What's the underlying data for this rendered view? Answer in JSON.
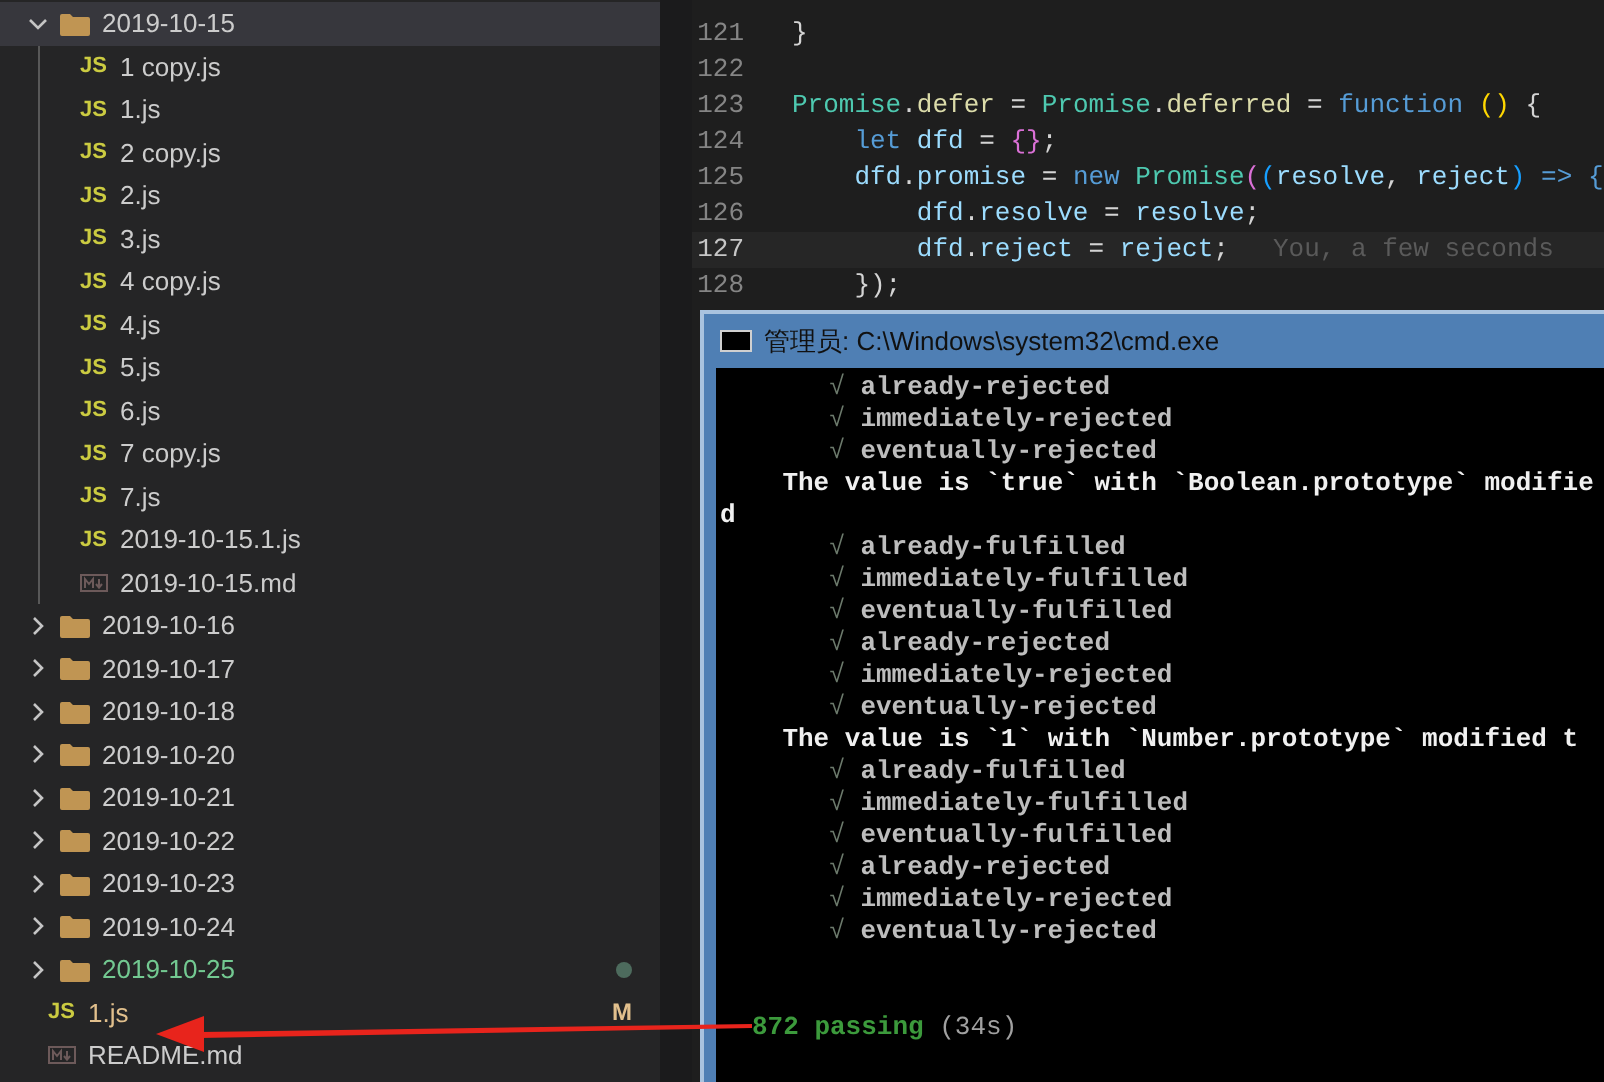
{
  "explorer": {
    "items": [
      {
        "kind": "folder",
        "name": "2019-10-15",
        "expanded": true,
        "selected": true,
        "children": [
          {
            "kind": "js",
            "icon_label": "JS",
            "name": "1 copy.js"
          },
          {
            "kind": "js",
            "icon_label": "JS",
            "name": "1.js"
          },
          {
            "kind": "js",
            "icon_label": "JS",
            "name": "2 copy.js"
          },
          {
            "kind": "js",
            "icon_label": "JS",
            "name": "2.js"
          },
          {
            "kind": "js",
            "icon_label": "JS",
            "name": "3.js"
          },
          {
            "kind": "js",
            "icon_label": "JS",
            "name": "4 copy.js"
          },
          {
            "kind": "js",
            "icon_label": "JS",
            "name": "4.js"
          },
          {
            "kind": "js",
            "icon_label": "JS",
            "name": "5.js"
          },
          {
            "kind": "js",
            "icon_label": "JS",
            "name": "6.js"
          },
          {
            "kind": "js",
            "icon_label": "JS",
            "name": "7 copy.js"
          },
          {
            "kind": "js",
            "icon_label": "JS",
            "name": "7.js"
          },
          {
            "kind": "js",
            "icon_label": "JS",
            "name": "2019-10-15.1.js"
          },
          {
            "kind": "md",
            "name": "2019-10-15.md"
          }
        ]
      },
      {
        "kind": "folder",
        "name": "2019-10-16",
        "expanded": false,
        "selected": false,
        "untracked": false
      },
      {
        "kind": "folder",
        "name": "2019-10-17",
        "expanded": false,
        "selected": false,
        "untracked": false
      },
      {
        "kind": "folder",
        "name": "2019-10-18",
        "expanded": false,
        "selected": false,
        "untracked": false
      },
      {
        "kind": "folder",
        "name": "2019-10-20",
        "expanded": false,
        "selected": false,
        "untracked": false
      },
      {
        "kind": "folder",
        "name": "2019-10-21",
        "expanded": false,
        "selected": false,
        "untracked": false
      },
      {
        "kind": "folder",
        "name": "2019-10-22",
        "expanded": false,
        "selected": false,
        "untracked": false
      },
      {
        "kind": "folder",
        "name": "2019-10-23",
        "expanded": false,
        "selected": false,
        "untracked": false
      },
      {
        "kind": "folder",
        "name": "2019-10-24",
        "expanded": false,
        "selected": false,
        "untracked": false
      },
      {
        "kind": "folder",
        "name": "2019-10-25",
        "expanded": false,
        "selected": false,
        "untracked": true
      },
      {
        "kind": "js",
        "icon_label": "JS",
        "name": "1.js",
        "untracked": false,
        "badge": "M"
      },
      {
        "kind": "md",
        "name": "README.md",
        "untracked": false
      }
    ]
  },
  "editor": {
    "lines": [
      {
        "number": "121",
        "current": false,
        "tokens": [
          {
            "text": "}",
            "kind": "punct"
          }
        ]
      },
      {
        "number": "122",
        "current": false
      },
      {
        "number": "123",
        "current": false,
        "tokens": [
          {
            "text": "Promise",
            "kind": "class"
          },
          {
            "text": ".",
            "kind": "punct"
          },
          {
            "text": "defer",
            "kind": "prop"
          },
          {
            "text": " = ",
            "kind": "punct"
          },
          {
            "text": "Promise",
            "kind": "class"
          },
          {
            "text": ".",
            "kind": "punct"
          },
          {
            "text": "deferred",
            "kind": "func"
          },
          {
            "text": " = ",
            "kind": "punct"
          },
          {
            "text": "function ",
            "kind": "keyword"
          },
          {
            "text": "()",
            "kind": "bracket"
          },
          {
            "text": " {",
            "kind": "punct"
          }
        ]
      },
      {
        "number": "124",
        "current": false,
        "kind": "nested",
        "tokens": [
          {
            "text": "let ",
            "kind": "keyword"
          },
          {
            "text": "dfd",
            "kind": "var"
          },
          {
            "text": " = ",
            "kind": "punct"
          },
          {
            "text": "{}",
            "kind": "bracket2"
          },
          {
            "text": ";",
            "kind": "punct"
          }
        ]
      },
      {
        "number": "125",
        "current": false,
        "kind": "nested",
        "tokens": [
          {
            "text": "dfd",
            "kind": "var"
          },
          {
            "text": ".",
            "kind": "punct"
          },
          {
            "text": "promise",
            "kind": "var"
          },
          {
            "text": " = ",
            "kind": "punct"
          },
          {
            "text": "new ",
            "kind": "keyword"
          },
          {
            "text": "Promise",
            "kind": "class"
          },
          {
            "text": "(",
            "kind": "bracket2"
          },
          {
            "text": "(",
            "kind": "bracket3"
          },
          {
            "text": "resolve",
            "kind": "var"
          },
          {
            "text": ", ",
            "kind": "punct"
          },
          {
            "text": "reject",
            "kind": "var"
          },
          {
            "text": ")",
            "kind": "bracket3"
          },
          {
            "text": " => {",
            "kind": "keyword"
          }
        ]
      },
      {
        "number": "126",
        "current": false,
        "kind": "deep",
        "tokens": [
          {
            "text": "dfd",
            "kind": "var"
          },
          {
            "text": ".",
            "kind": "punct"
          },
          {
            "text": "resolve",
            "kind": "var"
          },
          {
            "text": " = ",
            "kind": "punct"
          },
          {
            "text": "resolve",
            "kind": "var"
          },
          {
            "text": ";",
            "kind": "punct"
          }
        ]
      },
      {
        "number": "127",
        "current": true,
        "kind": "deep",
        "tokens": [
          {
            "text": "dfd",
            "kind": "var"
          },
          {
            "text": ".",
            "kind": "punct"
          },
          {
            "text": "reject",
            "kind": "var"
          },
          {
            "text": " = ",
            "kind": "punct"
          },
          {
            "text": "reject",
            "kind": "var"
          },
          {
            "text": ";",
            "kind": "punct"
          }
        ],
        "blame": "You, a few seconds"
      },
      {
        "number": "128",
        "current": false,
        "kind": "nested",
        "tokens": [
          {
            "text": "});",
            "kind": "punct"
          }
        ]
      }
    ]
  },
  "console": {
    "title": "管理员: C:\\Windows\\system32\\cmd.exe",
    "lines": [
      {
        "kind": "pass",
        "check": "√",
        "text": "already-rejected"
      },
      {
        "kind": "pass",
        "check": "√",
        "text": "immediately-rejected"
      },
      {
        "kind": "pass",
        "check": "√",
        "text": "eventually-rejected"
      },
      {
        "kind": "message",
        "text": "The value is `true` with `Boolean.prototype` modifie"
      },
      {
        "kind": "plain",
        "text": "d"
      },
      {
        "kind": "pass",
        "check": "√",
        "text": "already-fulfilled"
      },
      {
        "kind": "pass",
        "check": "√",
        "text": "immediately-fulfilled"
      },
      {
        "kind": "pass",
        "check": "√",
        "text": "eventually-fulfilled"
      },
      {
        "kind": "pass",
        "check": "√",
        "text": "already-rejected"
      },
      {
        "kind": "pass",
        "check": "√",
        "text": "immediately-rejected"
      },
      {
        "kind": "pass",
        "check": "√",
        "text": "eventually-rejected"
      },
      {
        "kind": "message",
        "text": "The value is `1` with `Number.prototype` modified t"
      },
      {
        "kind": "pass",
        "check": "√",
        "text": "already-fulfilled"
      },
      {
        "kind": "pass",
        "check": "√",
        "text": "immediately-fulfilled"
      },
      {
        "kind": "pass",
        "check": "√",
        "text": "eventually-fulfilled"
      },
      {
        "kind": "pass",
        "check": "√",
        "text": "already-rejected"
      },
      {
        "kind": "pass",
        "check": "√",
        "text": "immediately-rejected"
      },
      {
        "kind": "pass",
        "check": "√",
        "text": "eventually-rejected"
      },
      {
        "kind": "blank"
      },
      {
        "kind": "blank"
      },
      {
        "kind": "summary",
        "text": "872 passing",
        "time": "(34s)"
      }
    ]
  }
}
